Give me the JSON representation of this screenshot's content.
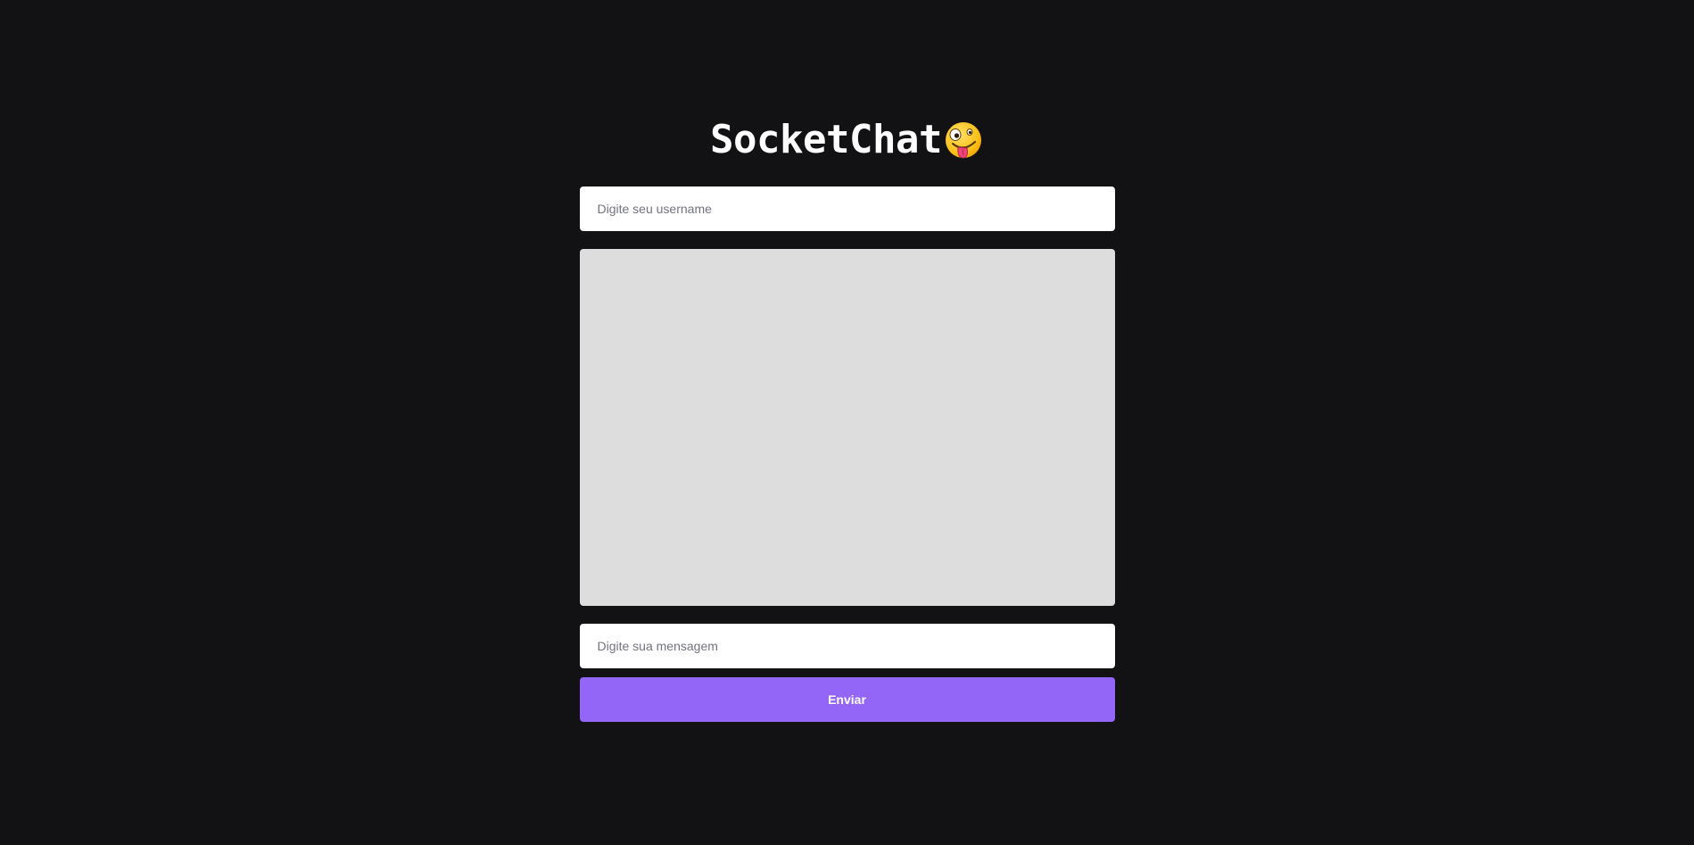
{
  "app": {
    "title": "SocketChat",
    "title_icon": "zany-face-emoji-icon"
  },
  "username_field": {
    "placeholder": "Digite seu username",
    "value": ""
  },
  "messages": {
    "items": []
  },
  "message_field": {
    "placeholder": "Digite sua mensagem",
    "value": ""
  },
  "send_button": {
    "label": "Enviar"
  },
  "colors": {
    "background": "#121214",
    "accent": "#9466f8",
    "panel": "#dddddd",
    "input_bg": "#ffffff"
  }
}
